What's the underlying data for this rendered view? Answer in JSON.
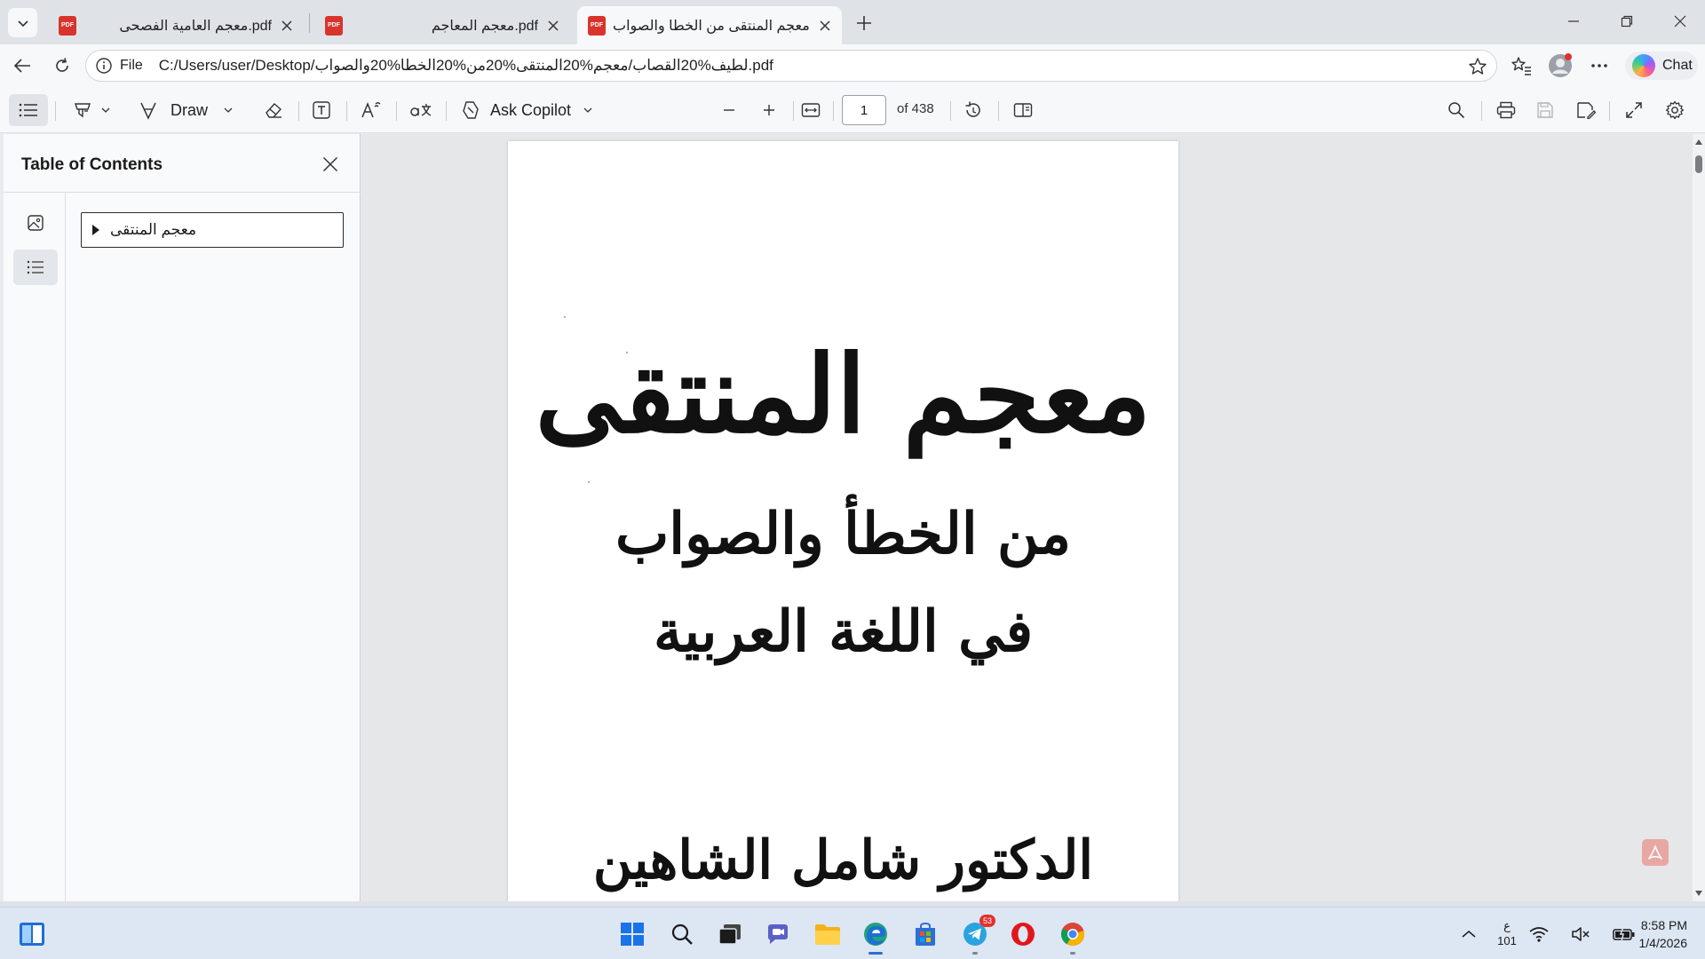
{
  "browser": {
    "tabs": [
      {
        "title": "معجم العامية الفصحى.pdf",
        "active": false
      },
      {
        "title": "معجم المعاجم.pdf",
        "active": false
      },
      {
        "title": "معجم المنتقى من الخطا والصواب.pdf",
        "active": true
      }
    ],
    "pdf_icon_text": "PDF",
    "address": {
      "scheme": "File",
      "url": "C:/Users/user/Desktop/لطيف%20القصاب/معجم%20المنتقى%20من%20الخطا%20والصواب.pdf"
    },
    "chat_label": "Chat"
  },
  "pdf_toolbar": {
    "draw_label": "Draw",
    "ask_copilot_label": "Ask Copilot",
    "current_page": "1",
    "page_total": "of 438"
  },
  "sidebar": {
    "title": "Table of Contents",
    "toc_items": [
      {
        "label": "معجم المنتقى"
      }
    ]
  },
  "document": {
    "title_line1": "معجم المنتقى",
    "title_line2": "من الخطأ والصواب",
    "title_line3": "في اللغة العربية",
    "author": "الدكتور شامل الشاهين"
  },
  "taskbar": {
    "telegram_badge": "53",
    "keyboard_lang": "ع",
    "keyboard_layout": "101",
    "time": "8:58 PM",
    "date": "1/4/2026"
  },
  "colors": {
    "accent": "#2b6fd6",
    "pdf_red": "#d9342b",
    "notification": "#e03030"
  }
}
